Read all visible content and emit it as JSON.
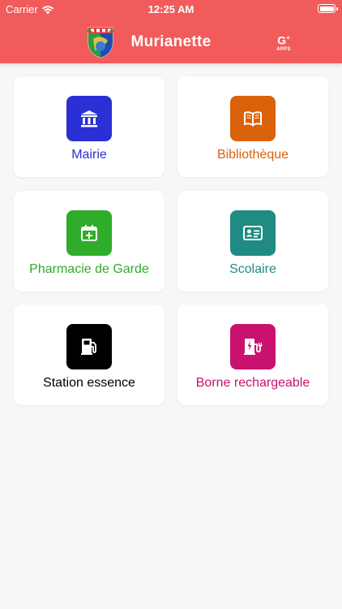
{
  "status_bar": {
    "carrier": "Carrier",
    "time": "12:25 AM"
  },
  "header": {
    "title": "Murianette",
    "apps_badge_letter": "G",
    "apps_badge_sup": "+",
    "apps_badge_text": "APPS",
    "background_color": "#f25b5b"
  },
  "tiles": [
    {
      "label": "Mairie",
      "icon": "city-hall-icon",
      "color": "#2b2fd6"
    },
    {
      "label": "Bibliothèque",
      "icon": "book-icon",
      "color": "#d9620b"
    },
    {
      "label": "Pharmacie de Garde",
      "icon": "calendar-plus-icon",
      "color": "#2eac2a"
    },
    {
      "label": "Scolaire",
      "icon": "id-card-icon",
      "color": "#1f8b82"
    },
    {
      "label": "Station essence",
      "icon": "gas-pump-icon",
      "color": "#000000"
    },
    {
      "label": "Borne rechargeable",
      "icon": "ev-charger-icon",
      "color": "#c9126e"
    }
  ]
}
